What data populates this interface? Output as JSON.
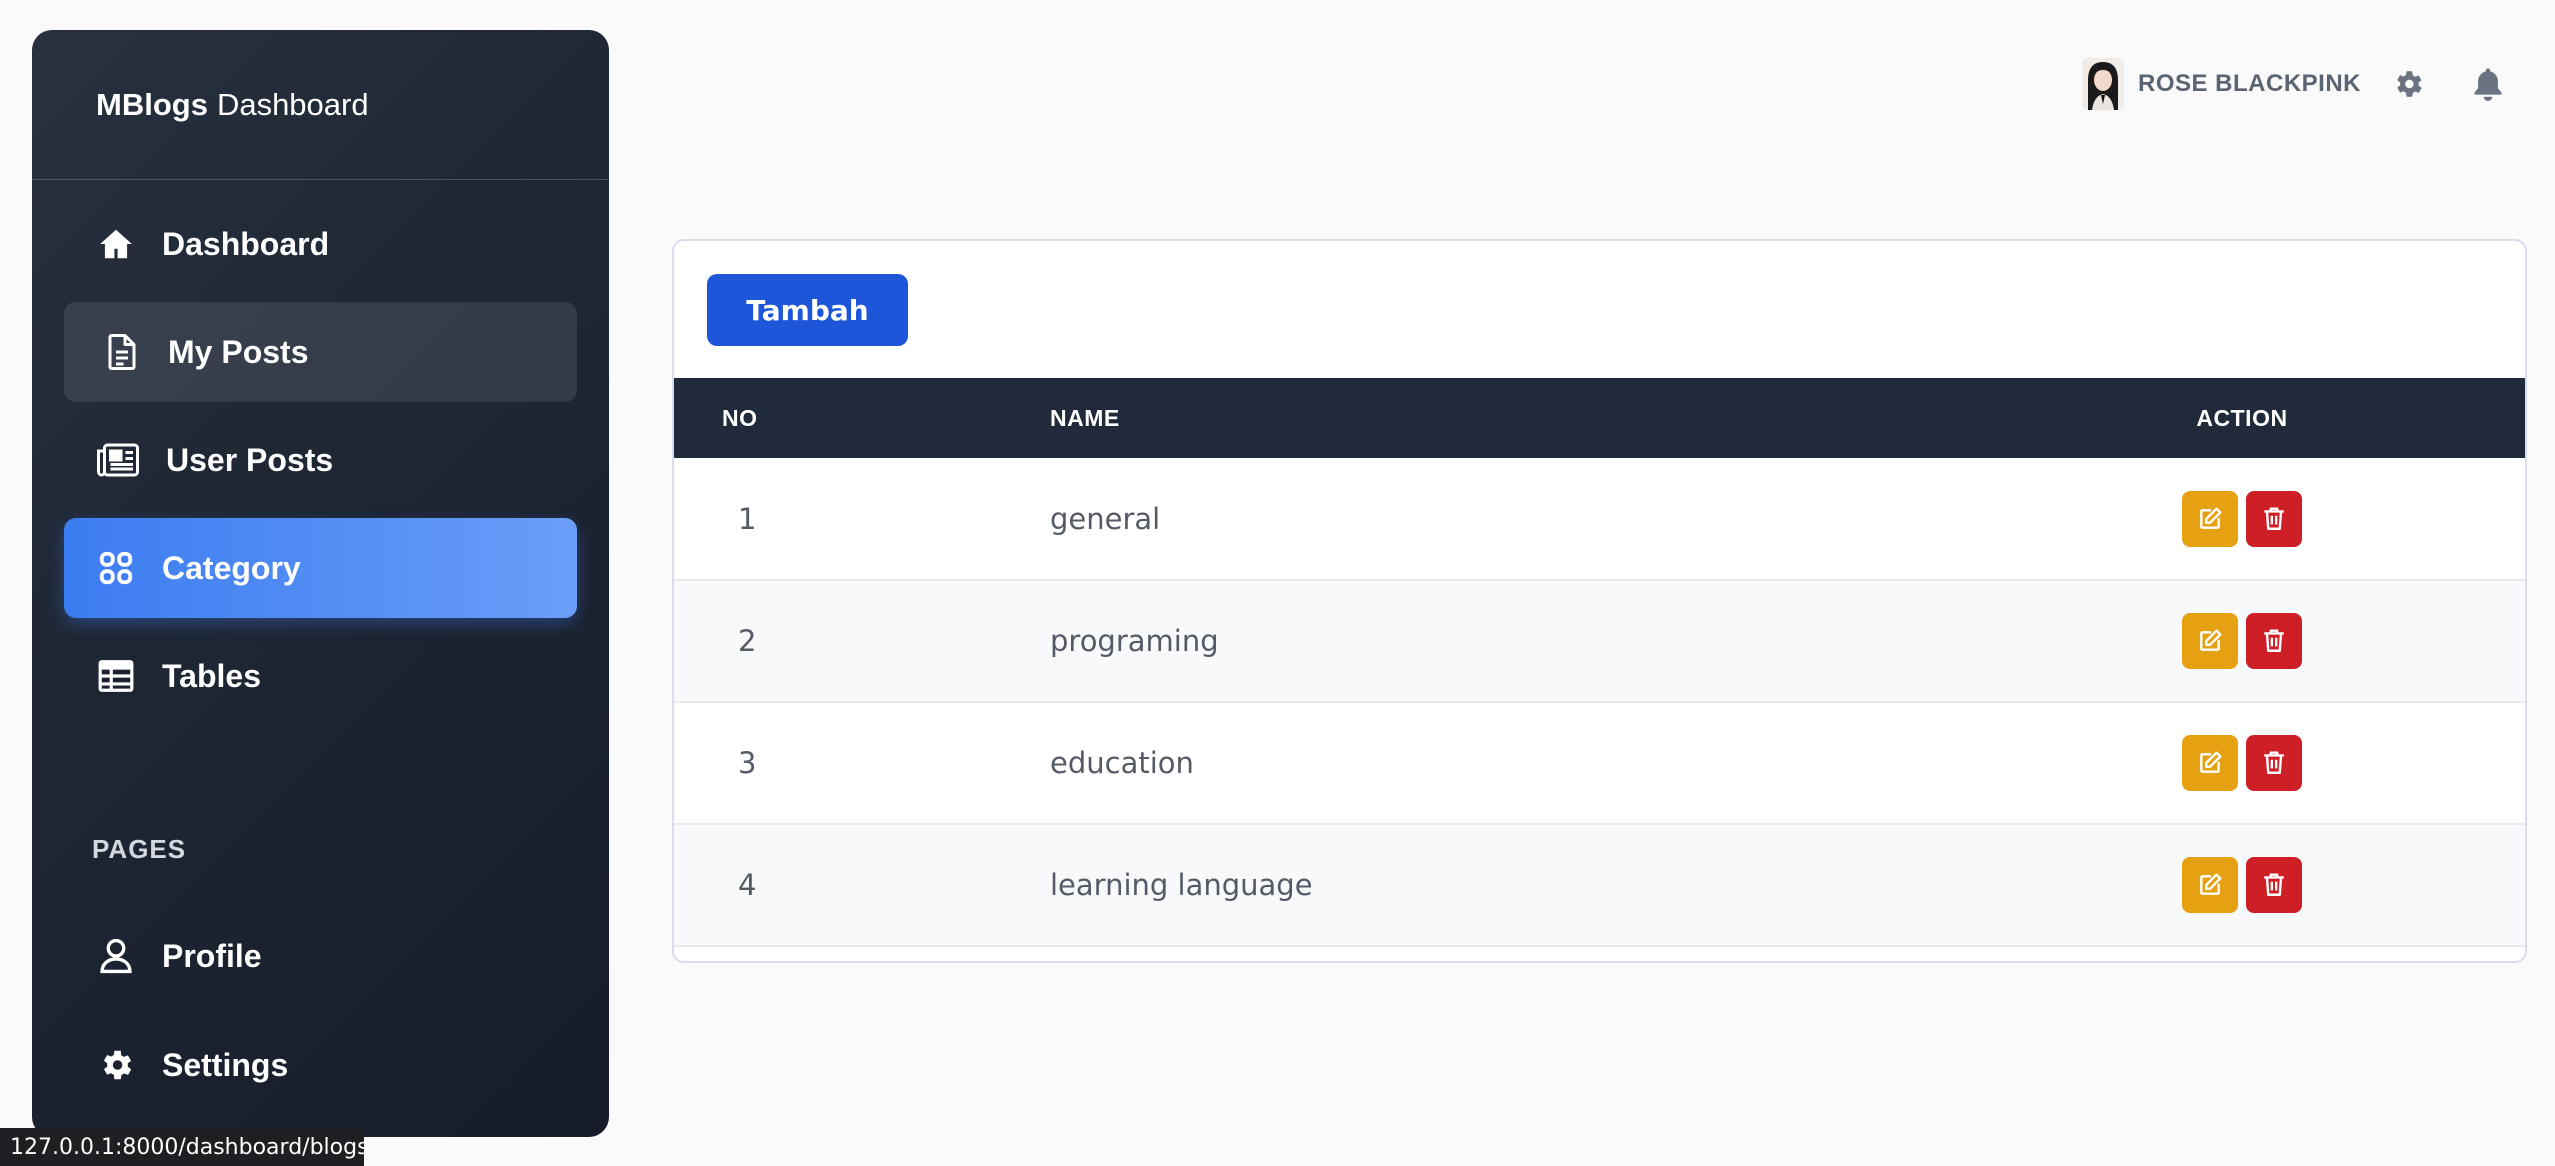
{
  "brand": {
    "bold": "MBlogs",
    "light": "Dashboard"
  },
  "sidebar": {
    "items": [
      {
        "label": "Dashboard",
        "icon": "home-icon"
      },
      {
        "label": "My Posts",
        "icon": "document-icon"
      },
      {
        "label": "User Posts",
        "icon": "newspaper-icon"
      },
      {
        "label": "Category",
        "icon": "grid-icon"
      },
      {
        "label": "Tables",
        "icon": "table-icon"
      }
    ],
    "section_title": "PAGES",
    "pages": [
      {
        "label": "Profile",
        "icon": "user-icon"
      },
      {
        "label": "Settings",
        "icon": "gear-icon"
      }
    ]
  },
  "header": {
    "username": "ROSE BLACKPINK"
  },
  "main": {
    "add_button": "Tambah",
    "table": {
      "headers": {
        "no": "NO",
        "name": "NAME",
        "action": "ACTION"
      },
      "rows": [
        {
          "no": "1",
          "name": "general"
        },
        {
          "no": "2",
          "name": "programing"
        },
        {
          "no": "3",
          "name": "education"
        },
        {
          "no": "4",
          "name": "learning language"
        }
      ]
    }
  },
  "statusbar": {
    "url": "127.0.0.1:8000/dashboard/blogs"
  },
  "colors": {
    "accent": "#1d56d9",
    "sidebar_active": "#3b7cf1",
    "edit": "#e6a113",
    "delete": "#cf1f26",
    "table_header": "#212a3b"
  }
}
